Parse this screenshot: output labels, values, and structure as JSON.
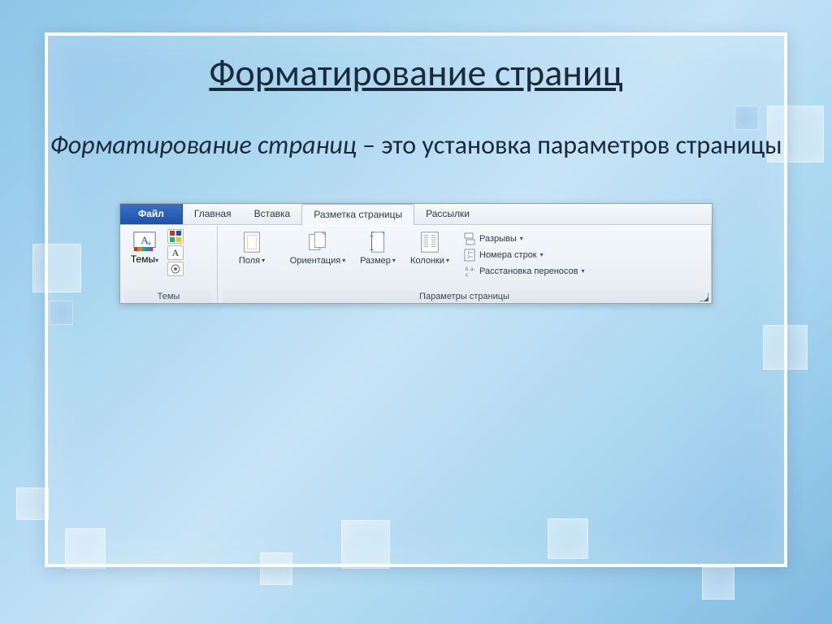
{
  "slide": {
    "title": "Форматирование страниц",
    "term": "Форматирование страниц",
    "definition_rest": " – это установка параметров страницы"
  },
  "ribbon": {
    "tabs": {
      "file": "Файл",
      "home": "Главная",
      "insert": "Вставка",
      "page_layout": "Разметка страницы",
      "mailings": "Рассылки"
    },
    "groups": {
      "themes": {
        "label": "Темы",
        "button": "Темы"
      },
      "page_setup": {
        "label": "Параметры страницы",
        "margins": "Поля",
        "orientation": "Ориентация",
        "size": "Размер",
        "columns": "Колонки",
        "breaks": "Разрывы",
        "line_numbers": "Номера строк",
        "hyphenation": "Расстановка переносов"
      }
    }
  }
}
